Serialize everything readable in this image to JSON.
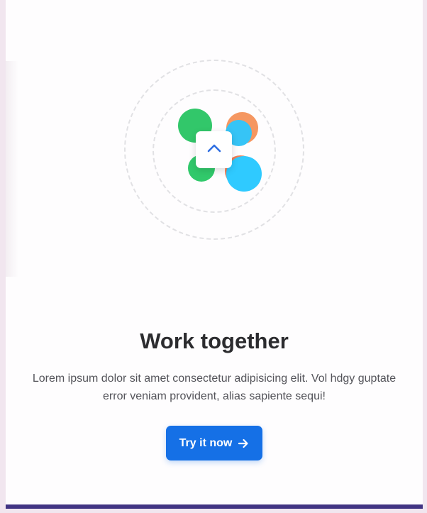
{
  "feature": {
    "title": "Work together",
    "description": "Lorem ipsum dolor sit amet consectetur adipisicing elit. Vol hdgy guptate error veniam provident, alias sapiente sequi!",
    "cta_label": "Try it now",
    "cta_icon": "arrow-right-icon"
  },
  "illustration": {
    "center_icon": "chevron-up-icon",
    "blob_colors": [
      "#32c76a",
      "#f59761",
      "#36c4f6",
      "#31c96b",
      "#ef7f57",
      "#2fcaff"
    ]
  },
  "theme": {
    "accent": "#1570e6",
    "footer_bar": "#413483"
  }
}
